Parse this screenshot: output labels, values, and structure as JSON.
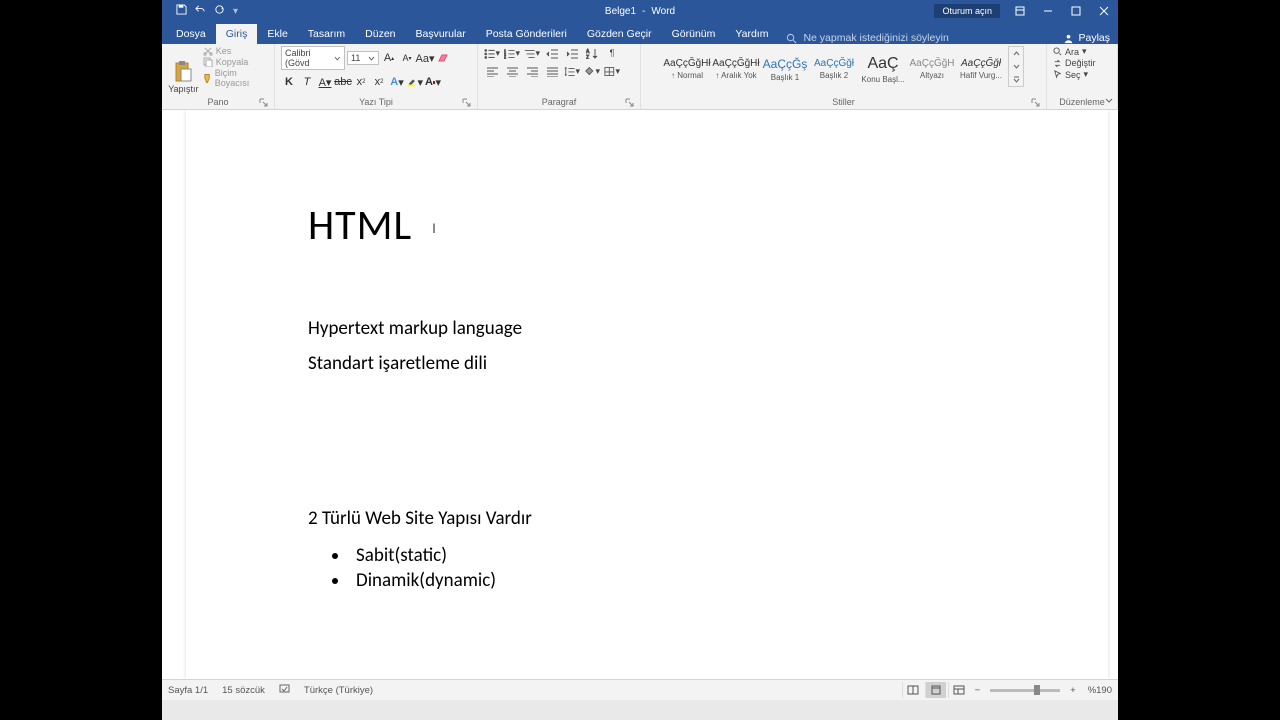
{
  "title": {
    "doc": "Belge1",
    "app": "Word"
  },
  "signin": "Oturum açın",
  "tabs": [
    "Dosya",
    "Giriş",
    "Ekle",
    "Tasarım",
    "Düzen",
    "Başvurular",
    "Posta Gönderileri",
    "Gözden Geçir",
    "Görünüm",
    "Yardım"
  ],
  "active_tab": 1,
  "tell_me": "Ne yapmak istediğinizi söyleyin",
  "share": "Paylaş",
  "clipboard": {
    "paste": "Yapıştır",
    "cut": "Kes",
    "copy": "Kopyala",
    "painter": "Biçim Boyacısı",
    "label": "Pano"
  },
  "font": {
    "name": "Calibri (Gövd",
    "size": "11",
    "label": "Yazı Tipi"
  },
  "paragraph": {
    "label": "Paragraf"
  },
  "styles": {
    "label": "Stiller",
    "items": [
      {
        "prev": "AaÇçĞğHł",
        "name": "↑ Normal"
      },
      {
        "prev": "AaÇçĞğHł",
        "name": "↑ Aralık Yok"
      },
      {
        "prev": "AaÇçĞş",
        "name": "Başlık 1"
      },
      {
        "prev": "AaÇçĞğł",
        "name": "Başlık 2"
      },
      {
        "prev": "AaÇ",
        "name": "Konu Başl..."
      },
      {
        "prev": "AaÇçĞğH",
        "name": "Altyazı"
      },
      {
        "prev": "AaÇçĞğł",
        "name": "Hafif Vurg..."
      }
    ]
  },
  "editing": {
    "find": "Ara",
    "replace": "Değiştir",
    "select": "Seç",
    "label": "Düzenleme"
  },
  "document": {
    "heading": "HTML",
    "p1": "Hypertext markup language",
    "p2": "Standart işaretleme dili",
    "p3": "2 Türlü Web Site Yapısı Vardır",
    "li1": "Sabit(static)",
    "li2": "Dinamik(dynamic)"
  },
  "status": {
    "page": "Sayfa 1/1",
    "words": "15 sözcük",
    "lang": "Türkçe (Türkiye)",
    "zoom": "%190"
  }
}
